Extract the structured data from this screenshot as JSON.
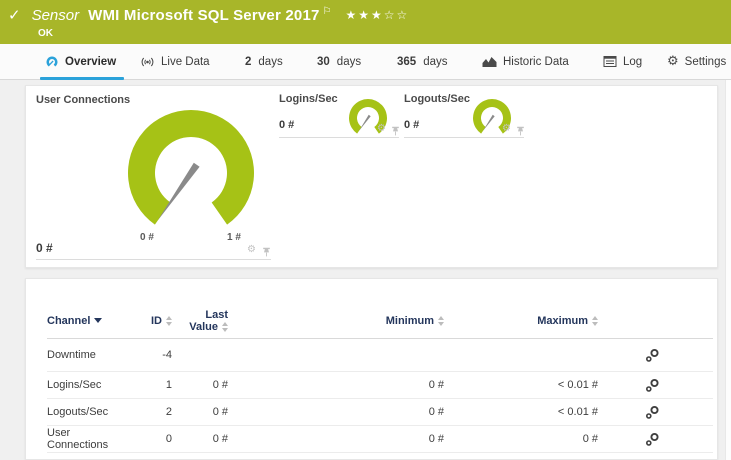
{
  "colors": {
    "header_green": "#a8b629",
    "gauge_green": "#a6c216",
    "accent_blue": "#2ba2da",
    "needle_gray": "#8a8a8a",
    "table_header_text": "#24365c"
  },
  "icons": {
    "check": "✓",
    "flag": "⚐",
    "stars_filled": "★★★",
    "stars_empty": "☆☆",
    "gear": "⚙"
  },
  "header": {
    "kind": "Sensor",
    "title": "WMI Microsoft SQL Server 2017",
    "status": "OK",
    "priority_stars_filled": 3,
    "priority_stars_empty": 2
  },
  "tabs": [
    {
      "label": "Overview",
      "selected": true
    },
    {
      "label": "Live Data",
      "selected": false
    },
    {
      "num": "2",
      "label": "days",
      "selected": false
    },
    {
      "num": "30",
      "label": "days",
      "selected": false
    },
    {
      "num": "365",
      "label": "days",
      "selected": false
    },
    {
      "label": "Historic Data",
      "selected": false
    },
    {
      "label": "Log",
      "selected": false
    },
    {
      "label": "Settings",
      "selected": false
    }
  ],
  "gauges": {
    "main": {
      "title": "User Connections",
      "value": "0 #",
      "scale_min": "0 #",
      "scale_max": "1 #"
    },
    "logins": {
      "title": "Logins/Sec",
      "value": "0 #"
    },
    "logouts": {
      "title": "Logouts/Sec",
      "value": "0 #"
    }
  },
  "table": {
    "headers": {
      "channel": "Channel",
      "id": "ID",
      "last_value_l1": "Last",
      "last_value_l2": "Value",
      "minimum": "Minimum",
      "maximum": "Maximum"
    },
    "rows": [
      {
        "channel": "Downtime",
        "id": "-4",
        "last": "",
        "min": "",
        "max": ""
      },
      {
        "channel": "Logins/Sec",
        "id": "1",
        "last": "0 #",
        "min": "0 #",
        "max": "< 0.01 #"
      },
      {
        "channel": "Logouts/Sec",
        "id": "2",
        "last": "0 #",
        "min": "0 #",
        "max": "< 0.01 #"
      },
      {
        "channel": "User Connections",
        "id": "0",
        "last": "0 #",
        "min": "0 #",
        "max": "0 #"
      }
    ]
  }
}
